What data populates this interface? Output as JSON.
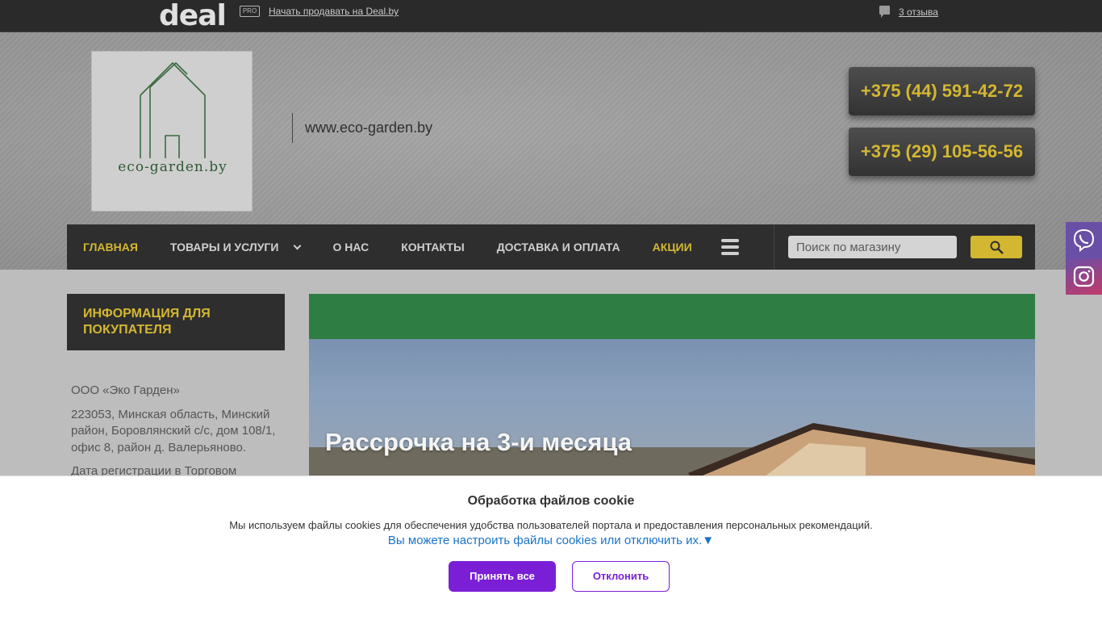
{
  "topbar": {
    "logo": "deal",
    "pro_badge": "PRO",
    "sell_link": "Начать продавать на Deal.by",
    "reviews_link": "3 отзыва"
  },
  "header": {
    "logo_text": "eco-garden.by",
    "site_url": "www.eco-garden.by",
    "phones": [
      "+375 (44) 591-42-72",
      "+375 (29) 105-56-56"
    ]
  },
  "nav": {
    "items": [
      {
        "label": "Главная"
      },
      {
        "label": "Товары и услуги"
      },
      {
        "label": "О нас"
      },
      {
        "label": "Контакты"
      },
      {
        "label": "Доставка и оплата"
      },
      {
        "label": "Акции"
      }
    ]
  },
  "search": {
    "placeholder": "Поиск по магазину"
  },
  "sidebar": {
    "title": "Информация для покупателя",
    "company": "ООО «Эко Гарден»",
    "address": "223053, Минская область, Минский район, Боровлянский с/с, дом 108/1, офис 8, район д. Валерьяново.",
    "registration": "Дата регистрации в Торговом"
  },
  "banner": {
    "text": "Рассрочка на 3-и месяца"
  },
  "cookie": {
    "title": "Обработка файлов cookie",
    "text": "Мы используем файлы cookies для обеспечения удобства пользователей портала и предоставления персональных рекомендаций.",
    "settings_link": "Вы можете настроить файлы cookies или отключить их.▼",
    "accept": "Принять все",
    "decline": "Отклонить"
  },
  "colors": {
    "accent_gold": "#d4b731",
    "dark_bar": "#2e2e2e",
    "cookie_purple": "#7b1fd6",
    "logo_green": "#2d5a33"
  }
}
